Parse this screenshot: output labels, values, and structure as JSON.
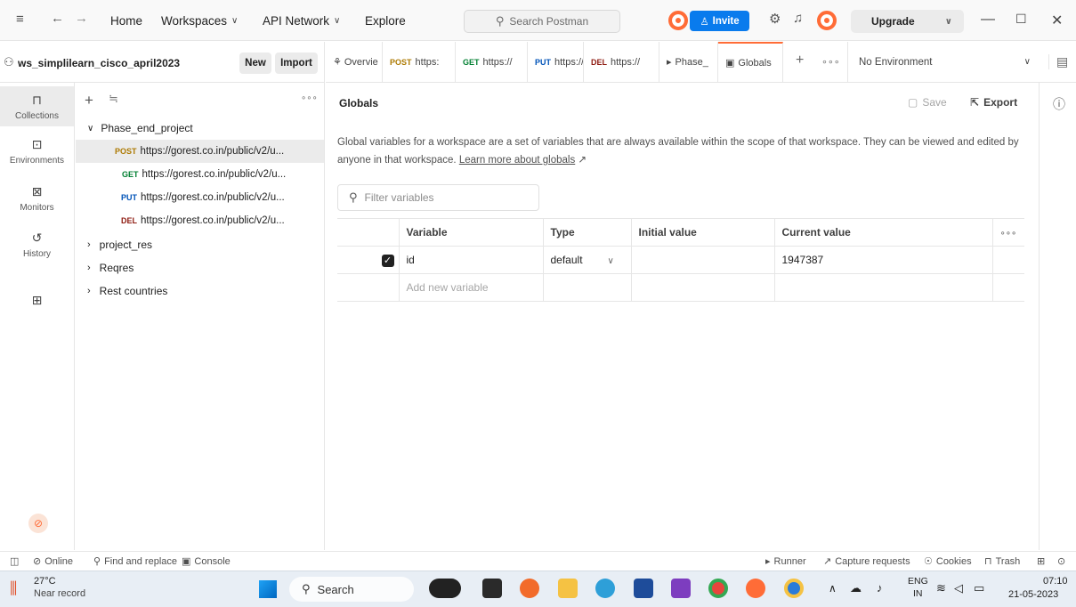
{
  "titlebar": {
    "nav": {
      "home": "Home",
      "workspaces": "Workspaces",
      "api_network": "API Network",
      "explore": "Explore"
    },
    "search_placeholder": "Search Postman",
    "invite": "Invite",
    "upgrade": "Upgrade"
  },
  "workspace": {
    "name": "ws_simplilearn_cisco_april2023",
    "new_label": "New",
    "import_label": "Import"
  },
  "tabs": [
    {
      "method": "",
      "label": "Overvie"
    },
    {
      "method": "POST",
      "label": "https:"
    },
    {
      "method": "GET",
      "label": "https://"
    },
    {
      "method": "PUT",
      "label": "https://"
    },
    {
      "method": "DEL",
      "label": "https://"
    },
    {
      "method": "",
      "label": "Phase_"
    },
    {
      "method": "",
      "label": "Globals"
    }
  ],
  "environment": {
    "selected": "No Environment"
  },
  "sidebar": {
    "items": [
      {
        "label": "Collections"
      },
      {
        "label": "Environments"
      },
      {
        "label": "Monitors"
      },
      {
        "label": "History"
      }
    ]
  },
  "tree": {
    "root": "Phase_end_project",
    "requests": [
      {
        "method": "POST",
        "url": "https://gorest.co.in/public/v2/u..."
      },
      {
        "method": "GET",
        "url": "https://gorest.co.in/public/v2/u..."
      },
      {
        "method": "PUT",
        "url": "https://gorest.co.in/public/v2/u..."
      },
      {
        "method": "DEL",
        "url": "https://gorest.co.in/public/v2/u..."
      }
    ],
    "collections": [
      "project_res",
      "Reqres",
      "Rest countries"
    ]
  },
  "main": {
    "title": "Globals",
    "save_label": "Save",
    "export_label": "Export",
    "description": "Global variables for a workspace are a set of variables that are always available within the scope of that workspace. They can be viewed and edited by anyone in that workspace.",
    "learn_more": "Learn more about globals",
    "learn_more_arrow": "↗",
    "filter_placeholder": "Filter variables",
    "table": {
      "headers": [
        "Variable",
        "Type",
        "Initial value",
        "Current value"
      ],
      "rows": [
        {
          "variable": "id",
          "type": "default",
          "initial": "",
          "current": "1947387"
        }
      ],
      "add_placeholder": "Add new variable"
    }
  },
  "statusbar": {
    "online": "Online",
    "find_replace": "Find and replace",
    "console": "Console",
    "runner": "Runner",
    "capture": "Capture requests",
    "cookies": "Cookies",
    "trash": "Trash"
  },
  "taskbar": {
    "weather_temp": "27°C",
    "weather_desc": "Near record",
    "search": "Search",
    "lang_top": "ENG",
    "lang_bottom": "IN",
    "time": "07:10",
    "date": "21-05-2023"
  },
  "colors": {
    "accent": "#ff6c37",
    "invite_blue": "#097bed",
    "post": "#ad7a03",
    "get": "#007f31",
    "put": "#0053b8",
    "del": "#8e1a10"
  }
}
